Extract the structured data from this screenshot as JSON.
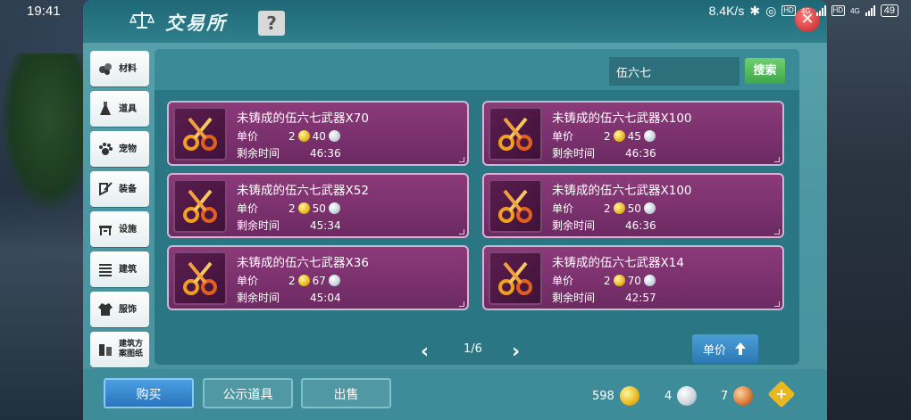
{
  "status_bar": {
    "time": "19:41",
    "network_speed": "8.4K/s",
    "net_label_1": "4G",
    "net_label_2": "4G",
    "battery": "49"
  },
  "window": {
    "title": "交易所",
    "help_label": "?",
    "close_label": "✕"
  },
  "sidebar": {
    "items": [
      {
        "label": "材料",
        "icon": "materials-icon"
      },
      {
        "label": "道具",
        "icon": "props-icon"
      },
      {
        "label": "宠物",
        "icon": "paw-icon"
      },
      {
        "label": "装备",
        "icon": "equipment-icon"
      },
      {
        "label": "设施",
        "icon": "facility-icon"
      },
      {
        "label": "建筑",
        "icon": "building-icon"
      },
      {
        "label": "服饰",
        "icon": "clothing-icon"
      },
      {
        "label": "建筑方案图纸",
        "icon": "blueprint-icon"
      }
    ]
  },
  "search": {
    "value": "伍六七",
    "button_label": "搜索"
  },
  "listings": [
    {
      "name": "未铸成的伍六七武器X70",
      "price_label": "单价",
      "gold": "2",
      "silver": "40",
      "time_label": "剩余时间",
      "time": "46:36"
    },
    {
      "name": "未铸成的伍六七武器X100",
      "price_label": "单价",
      "gold": "2",
      "silver": "45",
      "time_label": "剩余时间",
      "time": "46:36"
    },
    {
      "name": "未铸成的伍六七武器X52",
      "price_label": "单价",
      "gold": "2",
      "silver": "50",
      "time_label": "剩余时间",
      "time": "45:34"
    },
    {
      "name": "未铸成的伍六七武器X100",
      "price_label": "单价",
      "gold": "2",
      "silver": "50",
      "time_label": "剩余时间",
      "time": "46:36"
    },
    {
      "name": "未铸成的伍六七武器X36",
      "price_label": "单价",
      "gold": "2",
      "silver": "67",
      "time_label": "剩余时间",
      "time": "45:04"
    },
    {
      "name": "未铸成的伍六七武器X14",
      "price_label": "单价",
      "gold": "2",
      "silver": "70",
      "time_label": "剩余时间",
      "time": "42:57"
    }
  ],
  "pagination": {
    "text": "1/6",
    "prev": "‹",
    "next": "›"
  },
  "sort": {
    "label": "单价"
  },
  "bottom": {
    "tabs": {
      "buy": "购买",
      "public": "公示道具",
      "sell": "出售"
    },
    "currency": {
      "gold": "598",
      "silver": "4",
      "copper": "7"
    },
    "add_label": "+"
  },
  "colors": {
    "panel": "#4b96a2",
    "card": "#7a3270",
    "search_button": "#3ea84a",
    "buy_tab": "#2a74c0"
  }
}
